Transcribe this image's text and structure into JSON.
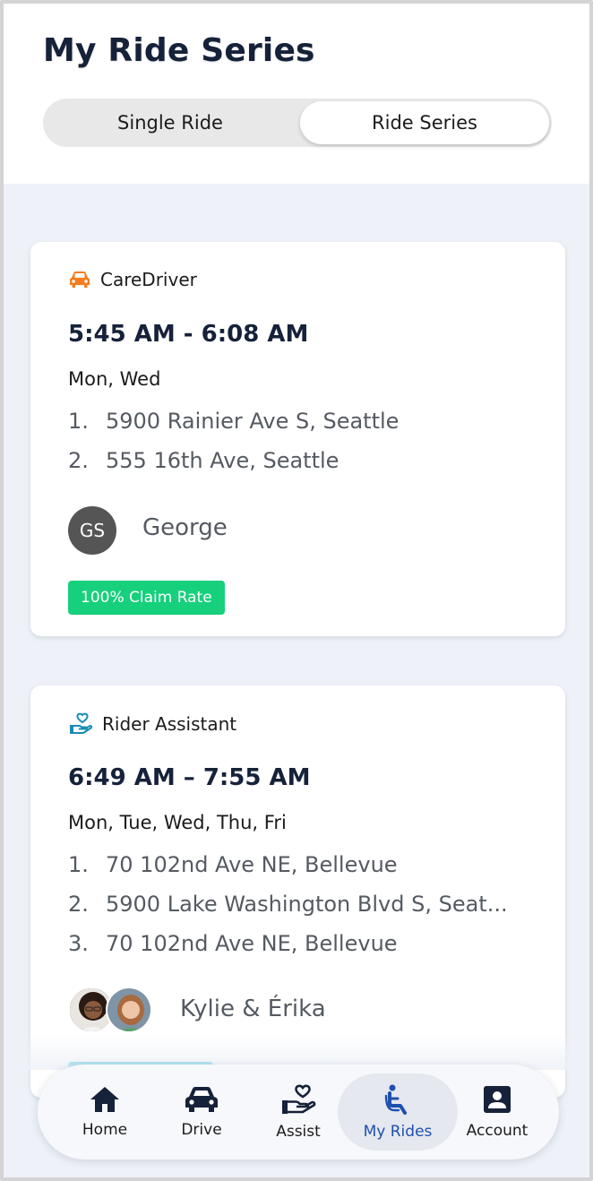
{
  "header": {
    "title": "My Ride Series",
    "tabs": [
      {
        "label": "Single Ride",
        "selected": false
      },
      {
        "label": "Ride Series",
        "selected": true
      }
    ]
  },
  "rides": [
    {
      "service": "CareDriver",
      "service_icon": "car-icon",
      "time": "5:45 AM - 6:08 AM",
      "days": "Mon, Wed",
      "stops": [
        {
          "num": "1.",
          "address": "5900 Rainier Ave S, Seattle"
        },
        {
          "num": "2.",
          "address": "555 16th Ave, Seattle"
        }
      ],
      "rider_initials": "GS",
      "rider_name": "George",
      "badge": "100% Claim Rate",
      "badge_color": "#16d07c"
    },
    {
      "service": "Rider Assistant",
      "service_icon": "heart-hand-icon",
      "time": "6:49 AM – 7:55 AM",
      "days": "Mon, Tue, Wed, Thu, Fri",
      "stops": [
        {
          "num": "1.",
          "address": "70 102nd Ave NE, Bellevue"
        },
        {
          "num": "2.",
          "address": "5900 Lake Washington Blvd S, Seat..."
        },
        {
          "num": "3.",
          "address": "70 102nd Ave NE, Bellevue"
        }
      ],
      "rider_name": "Kylie & Érika",
      "badge_color": "#16c2e0"
    }
  ],
  "nav": {
    "items": [
      {
        "label": "Home",
        "icon": "home-icon",
        "active": false
      },
      {
        "label": "Drive",
        "icon": "car-icon",
        "active": false
      },
      {
        "label": "Assist",
        "icon": "heart-hand-icon",
        "active": false
      },
      {
        "label": "My Rides",
        "icon": "seated-person-icon",
        "active": true
      },
      {
        "label": "Account",
        "icon": "account-icon",
        "active": false
      }
    ]
  },
  "colors": {
    "title": "#16213a",
    "accent_active": "#1f4fb0",
    "caredriver_icon": "#f57c1f",
    "assistant_icon": "#1a8cb4",
    "background": "#eef2f8"
  }
}
